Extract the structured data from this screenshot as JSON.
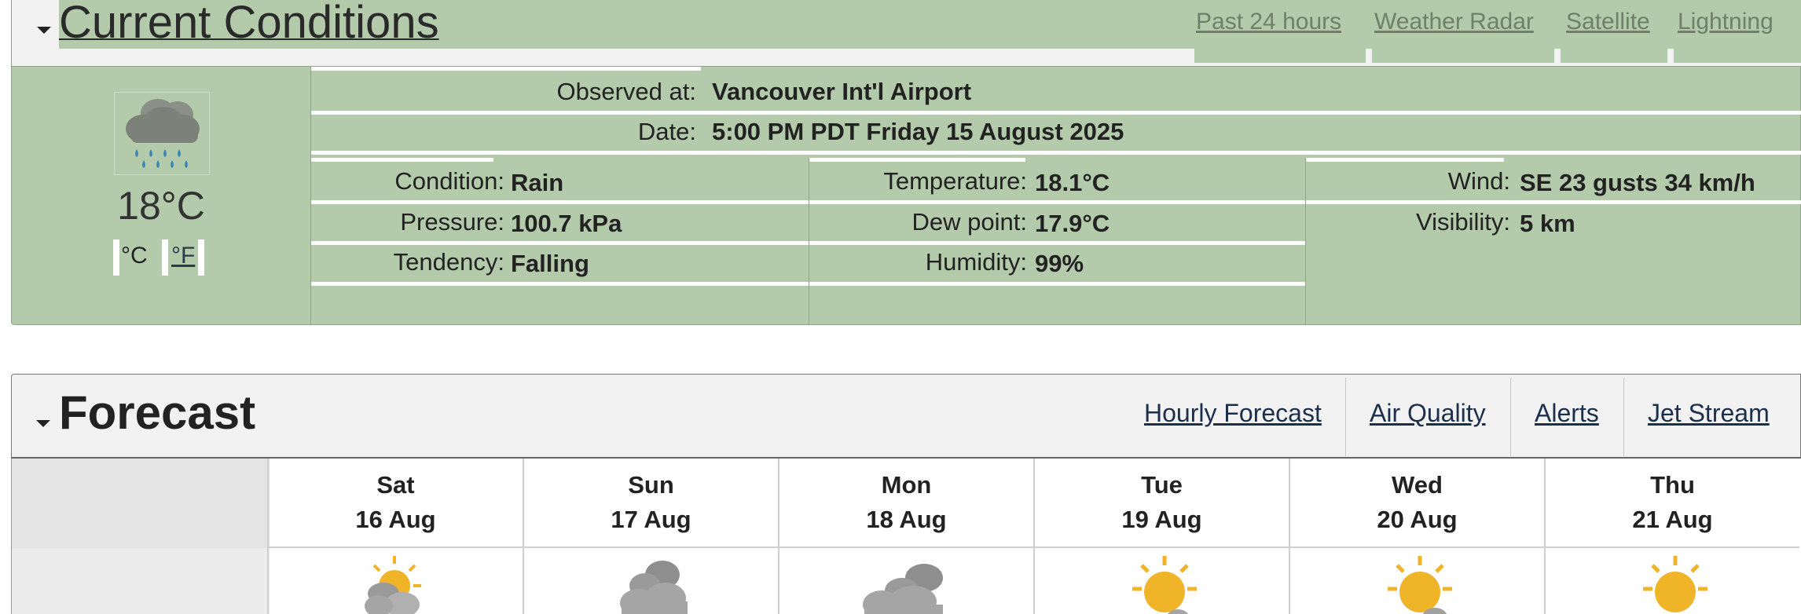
{
  "current": {
    "title": "Current Conditions",
    "links": [
      "Past 24 hours",
      "Weather Radar",
      "Satellite",
      "Lightning"
    ],
    "icon": "rain-cloud-icon",
    "temperature": "18°C",
    "unit_c": "°C",
    "unit_f": "°F",
    "observed_label": "Observed at:",
    "observed_value": "Vancouver Int'l Airport",
    "date_label": "Date:",
    "date_value": "5:00 PM PDT Friday 15 August 2025",
    "condition_label": "Condition:",
    "condition_value": "Rain",
    "pressure_label": "Pressure:",
    "pressure_value": "100.7 kPa",
    "tendency_label": "Tendency:",
    "tendency_value": "Falling",
    "temperature_label": "Temperature:",
    "temperature_value": "18.1°C",
    "dewpoint_label": "Dew point:",
    "dewpoint_value": "17.9°C",
    "humidity_label": "Humidity:",
    "humidity_value": "99%",
    "wind_label": "Wind:",
    "wind_value": "SE 23 gusts 34 km/h",
    "visibility_label": "Visibility:",
    "visibility_value": "5 km"
  },
  "forecast": {
    "title": "Forecast",
    "links": [
      "Hourly Forecast",
      "Air Quality",
      "Alerts",
      "Jet Stream"
    ],
    "days": [
      {
        "day": "Sat",
        "date": "16 Aug",
        "icon": "sun-cloud-icon"
      },
      {
        "day": "Sun",
        "date": "17 Aug",
        "icon": "cloud-icon"
      },
      {
        "day": "Mon",
        "date": "18 Aug",
        "icon": "cloud-icon"
      },
      {
        "day": "Tue",
        "date": "19 Aug",
        "icon": "sun-icon"
      },
      {
        "day": "Wed",
        "date": "20 Aug",
        "icon": "sun-small-cloud-icon"
      },
      {
        "day": "Thu",
        "date": "21 Aug",
        "icon": "sun-icon"
      }
    ]
  },
  "colors": {
    "panel_green": "#b4cbab",
    "sun": "#f0b429",
    "cloud_grey": "#9a9a9a"
  }
}
